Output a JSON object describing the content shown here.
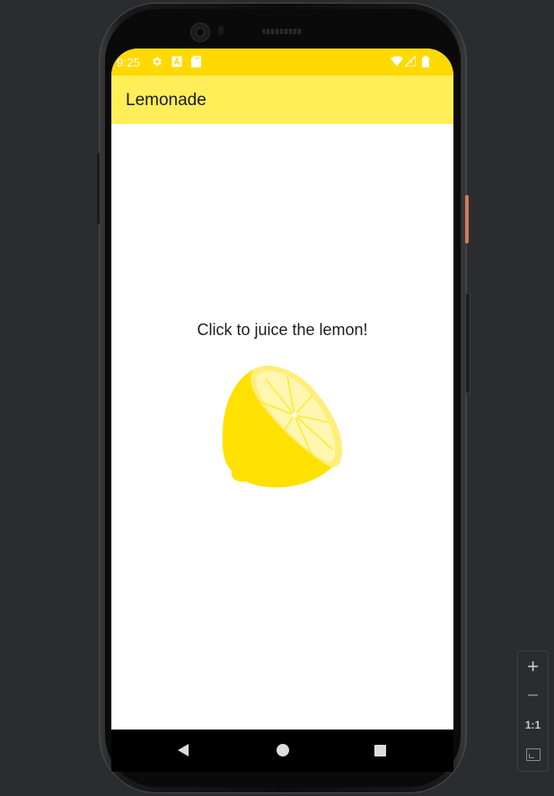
{
  "status_bar": {
    "time": "9:25",
    "left_icons": [
      "gear-icon",
      "a-box-icon",
      "sd-card-icon"
    ],
    "right_icons": [
      "wifi-icon",
      "signal-icon",
      "battery-icon"
    ],
    "color": "#ffd900"
  },
  "app_bar": {
    "title": "Lemonade",
    "color": "#ffee58"
  },
  "main": {
    "prompt": "Click to juice the lemon!",
    "image": "lemon-half-icon",
    "lemon_color": "#ffe100"
  },
  "nav_bar": {
    "buttons": [
      "back-icon",
      "home-icon",
      "recents-icon"
    ]
  },
  "emulator_zoom": {
    "zoom_in_label": "+",
    "zoom_out_label": "−",
    "actual_size_label": "1:1",
    "fit_icon": "fit-screen-icon"
  }
}
